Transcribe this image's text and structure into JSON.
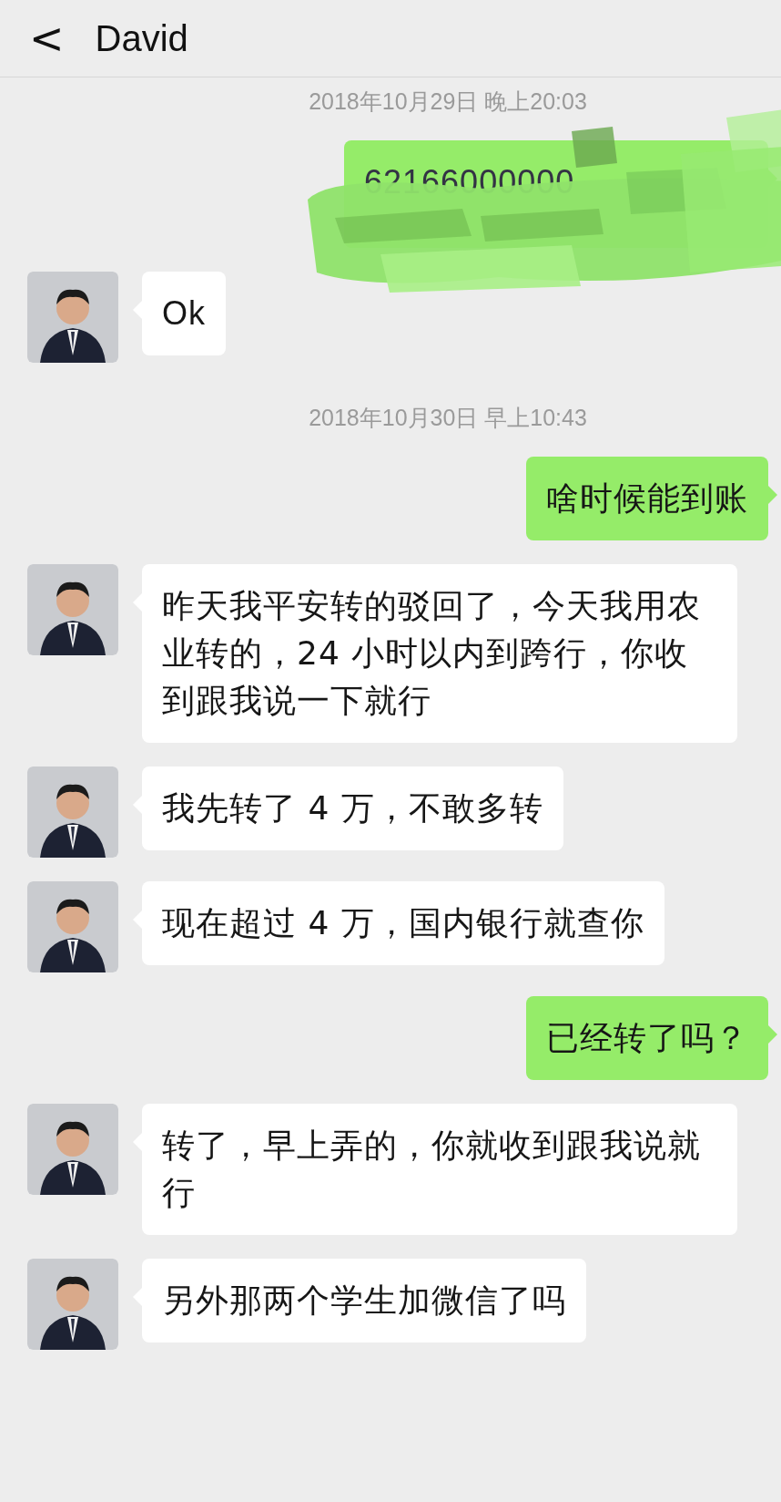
{
  "header": {
    "back": "<",
    "title": "David"
  },
  "messages": [
    {
      "kind": "time",
      "text": "2018年10月29日 晚上20:03"
    },
    {
      "kind": "masked",
      "text": "62166000000"
    },
    {
      "kind": "incoming",
      "text": "Ok"
    },
    {
      "kind": "time",
      "text": "2018年10月30日 早上10:43"
    },
    {
      "kind": "outgoing",
      "text": "啥时候能到账"
    },
    {
      "kind": "incoming",
      "text": "昨天我平安转的驳回了，今天我用农业转的，24 小时以内到跨行，你收到跟我说一下就行"
    },
    {
      "kind": "incoming",
      "text": "我先转了 4 万，不敢多转"
    },
    {
      "kind": "incoming",
      "text": "现在超过 4 万，国内银行就查你"
    },
    {
      "kind": "outgoing",
      "text": "已经转了吗？"
    },
    {
      "kind": "incoming",
      "text": "转了，早上弄的，你就收到跟我说就行"
    },
    {
      "kind": "incoming",
      "text": "另外那两个学生加微信了吗"
    }
  ]
}
